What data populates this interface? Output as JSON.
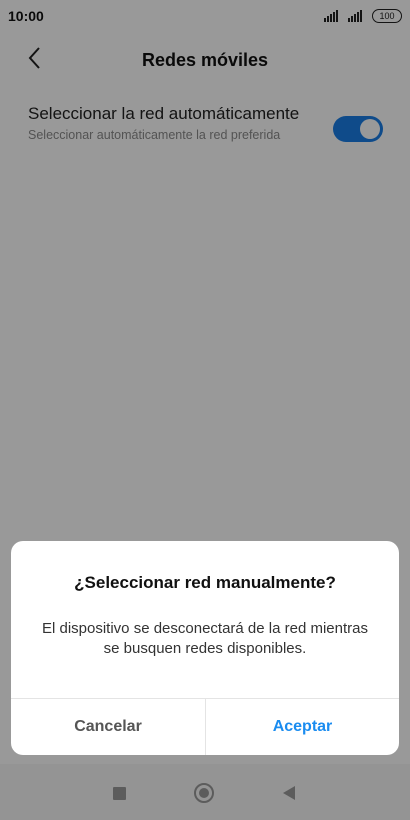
{
  "status_bar": {
    "time": "10:00",
    "battery": "100"
  },
  "header": {
    "title": "Redes móviles"
  },
  "setting": {
    "title": "Seleccionar la red automáticamente",
    "subtitle": "Seleccionar automáticamente la red preferida",
    "toggle_on": true
  },
  "dialog": {
    "title": "¿Seleccionar red manualmente?",
    "message": "El dispositivo se desconectará de la red mientras se busquen redes disponibles.",
    "cancel_label": "Cancelar",
    "ok_label": "Aceptar"
  },
  "nav": {
    "icons": [
      "recent-apps-icon",
      "home-icon",
      "back-triangle-icon"
    ]
  },
  "colors": {
    "accent": "#1a7ee6",
    "button_accent": "#1a8cf0",
    "scrim": "rgba(0,0,0,0.40)"
  }
}
